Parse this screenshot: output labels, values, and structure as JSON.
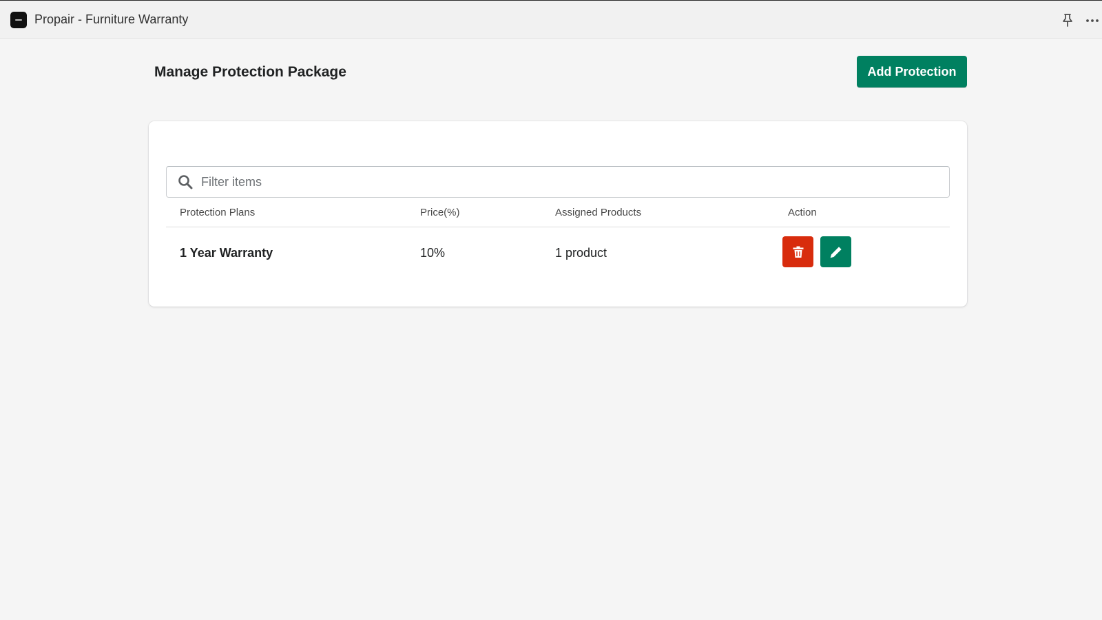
{
  "window": {
    "title": "Propair - Furniture Warranty",
    "icons": [
      "app-logo",
      "pin-icon",
      "more-icon"
    ]
  },
  "page": {
    "title": "Manage Protection Package",
    "add_button_label": "Add Protection"
  },
  "filter": {
    "placeholder": "Filter items",
    "value": ""
  },
  "table": {
    "columns": [
      "Protection Plans",
      "Price(%)",
      "Assigned Products",
      "Action"
    ],
    "rows": [
      {
        "plan": "1 Year Warranty",
        "price": "10%",
        "assigned": "1 product",
        "actions": [
          "delete-icon",
          "edit-icon"
        ]
      }
    ]
  },
  "colors": {
    "primary": "#008060",
    "danger": "#d82c0d",
    "background": "#f5f5f5",
    "card": "#ffffff"
  }
}
